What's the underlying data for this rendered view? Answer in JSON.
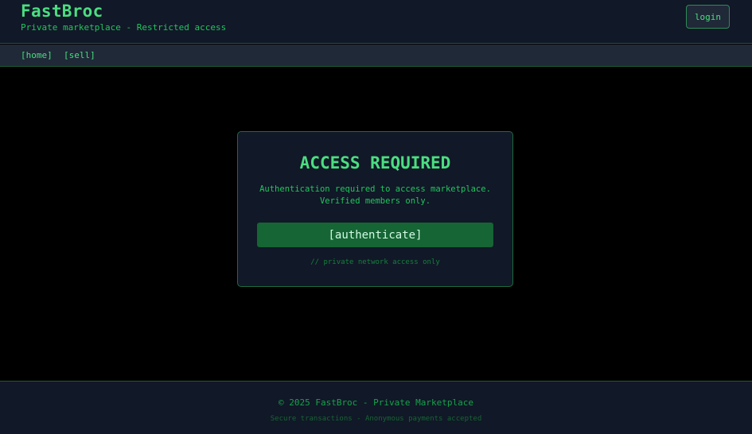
{
  "header": {
    "brand": "FastBroc",
    "tagline": "Private marketplace - Restricted access",
    "login_label": "login"
  },
  "nav": {
    "items": [
      {
        "label": "[home]"
      },
      {
        "label": "[sell]"
      }
    ]
  },
  "auth_card": {
    "title": "ACCESS REQUIRED",
    "line1": "Authentication required to access marketplace.",
    "line2": "Verified members only.",
    "button_label": "[authenticate]",
    "note": "// private network access only"
  },
  "footer": {
    "copyright": "© 2025 FastBroc - Private Marketplace",
    "subtext": "Secure transactions - Anonymous payments accepted"
  },
  "colors": {
    "accent": "#4ade80",
    "background": "#000000",
    "panel": "#111827",
    "button": "#166534"
  }
}
